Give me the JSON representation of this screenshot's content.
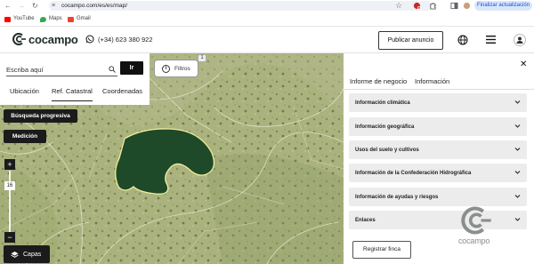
{
  "browser": {
    "url": "cocampo.com/es/es/map/",
    "update_button": "Finalizar actualización",
    "bookmarks": [
      {
        "label": "YouTube",
        "color": "#ff0000"
      },
      {
        "label": "Maps",
        "color": "#34a853"
      },
      {
        "label": "Gmail",
        "color": "#ea4335"
      }
    ]
  },
  "header": {
    "brand": "cocampo",
    "phone": "(+34) 623 380 922",
    "publish_button": "Publicar anuncio"
  },
  "search": {
    "placeholder": "Escriba aquí",
    "go_button": "Ir",
    "tabs": [
      "Ubicación",
      "Ref. Catastral",
      "Coordenadas"
    ],
    "active_tab": "Ref. Catastral"
  },
  "map_controls": {
    "filters_button": "Filtros",
    "filters_badge": "1",
    "progressive_search_button": "Búsqueda progresiva",
    "measure_button": "Medición",
    "zoom_in": "+",
    "zoom_out": "−",
    "zoom_level": "16",
    "layers_button": "Capas"
  },
  "panel": {
    "tabs": [
      "Informe de negocio",
      "Información"
    ],
    "active_tab": "Información",
    "sections": [
      "Información climática",
      "Información geográfica",
      "Usos del suelo y cultivos",
      "Información de la Confederación Hidrográfica",
      "Información de ayudas y riesgos",
      "Enlaces"
    ],
    "register_button": "Registrar finca",
    "watermark": "cocampo"
  },
  "colors": {
    "parcel_fill": "#1f4a2a",
    "parcel_outline": "#f0ee9a",
    "accent_dark": "#1b1b1b"
  }
}
